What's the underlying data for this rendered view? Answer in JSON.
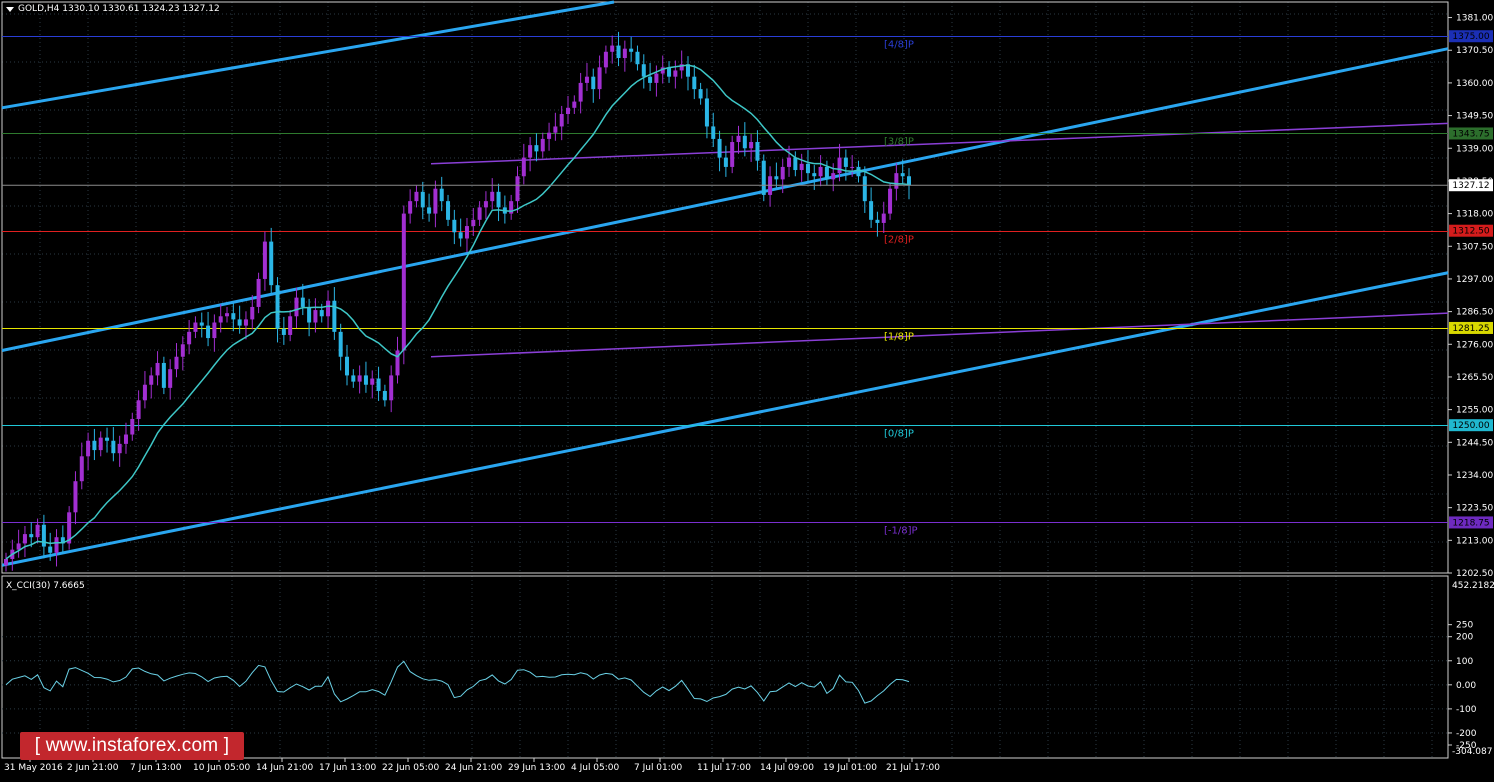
{
  "header": {
    "symbol_text": "GOLD,H4  1330.10 1330.61 1324.23 1327.12",
    "menu_icon": "triangle-down-icon"
  },
  "colors": {
    "background": "#000000",
    "grid": "#2b3a44",
    "bull": "#a22fd2",
    "bear": "#2bb6e6",
    "ma": "#3ec7c7",
    "channel": "#2aa6f0",
    "murrey_purple": "#8a3fd6",
    "cci": "#6ad1e6"
  },
  "price_axis": {
    "min": 1202.5,
    "max": 1386.0,
    "ticks": [
      "1381.00",
      "1370.50",
      "1360.00",
      "1349.50",
      "1339.00",
      "1328.50",
      "1318.00",
      "1307.50",
      "1297.00",
      "1286.50",
      "1276.00",
      "1265.50",
      "1255.00",
      "1244.50",
      "1234.00",
      "1223.50",
      "1213.00",
      "1202.50"
    ],
    "current_price": "1327.12"
  },
  "levels": [
    {
      "price": 1375.0,
      "label": "[4/8]P",
      "tag": "1375.00",
      "color": "#2a3ed6",
      "tagbg": "#1b2fb5"
    },
    {
      "price": 1343.75,
      "label": "[3/8]P",
      "tag": "1343.75",
      "color": "#2e7a2e",
      "tagbg": "#2c6e2c"
    },
    {
      "price": 1312.5,
      "label": "[2/8]P",
      "tag": "1312.50",
      "color": "#e02020",
      "tagbg": "#d41c1c"
    },
    {
      "price": 1281.25,
      "label": "[1/8]P",
      "tag": "1281.25",
      "color": "#e6e600",
      "tagbg": "#d8d800"
    },
    {
      "price": 1250.0,
      "label": "[0/8]P",
      "tag": "1250.00",
      "color": "#20c8d8",
      "tagbg": "#20b8d0"
    },
    {
      "price": 1218.75,
      "label": "[-1/8]P",
      "tag": "1218.75",
      "color": "#7a2fd0",
      "tagbg": "#6e2ac0"
    }
  ],
  "cci_panel": {
    "title": "X_CCI(30) 7.6665",
    "max_label": "452.2182",
    "min_label": "-304.087",
    "min": -304.087,
    "max": 452.2182,
    "ticks": [
      "250",
      "200",
      "100",
      "0.00",
      "-100",
      "-200",
      "-250"
    ]
  },
  "time_axis": {
    "labels": [
      "31 May 2016",
      "2 Jun 21:00",
      "7 Jun 13:00",
      "10 Jun 05:00",
      "14 Jun 21:00",
      "17 Jun 13:00",
      "22 Jun 05:00",
      "24 Jun 21:00",
      "29 Jun 13:00",
      "4 Jul 05:00",
      "7 Jul 01:00",
      "11 Jul 17:00",
      "14 Jul 09:00",
      "19 Jul 01:00",
      "21 Jul 17:00"
    ]
  },
  "watermark": {
    "text": "[  www.instaforex.com ]"
  },
  "chart_data": {
    "type": "candlestick",
    "symbol": "GOLD",
    "timeframe": "H4",
    "ohlc_header": {
      "open": 1330.1,
      "high": 1330.61,
      "low": 1324.23,
      "close": 1327.12
    },
    "close_path": [
      1207,
      1210,
      1212,
      1215,
      1214,
      1218,
      1211,
      1209,
      1214,
      1212,
      1222,
      1232,
      1240,
      1245,
      1242,
      1246,
      1245,
      1241,
      1244,
      1247,
      1252,
      1258,
      1263,
      1266,
      1270,
      1262,
      1268,
      1272,
      1276,
      1280,
      1283,
      1282,
      1278,
      1283,
      1285,
      1286,
      1284,
      1282,
      1284,
      1288,
      1297,
      1309,
      1295,
      1281,
      1279,
      1285,
      1291,
      1288,
      1283,
      1287,
      1285,
      1290,
      1280,
      1272,
      1266,
      1264,
      1266,
      1263,
      1265,
      1261,
      1258,
      1266,
      1274,
      1318,
      1322,
      1325,
      1320,
      1318,
      1326,
      1322,
      1316,
      1312,
      1310,
      1314,
      1316,
      1320,
      1322,
      1325,
      1320,
      1318,
      1322,
      1330,
      1336,
      1340,
      1338,
      1342,
      1344,
      1346,
      1350,
      1352,
      1354,
      1360,
      1362,
      1358,
      1365,
      1370,
      1372,
      1368,
      1371,
      1370,
      1366,
      1362,
      1360,
      1363,
      1365,
      1362,
      1364,
      1366,
      1362,
      1358,
      1355,
      1346,
      1342,
      1336,
      1333,
      1341,
      1343,
      1339,
      1341,
      1335,
      1324,
      1330,
      1329,
      1333,
      1336,
      1332,
      1334,
      1331,
      1330,
      1333,
      1329,
      1331,
      1336,
      1333,
      1333,
      1330,
      1322,
      1316,
      1315,
      1318,
      1326,
      1331,
      1330,
      1327
    ]
  }
}
